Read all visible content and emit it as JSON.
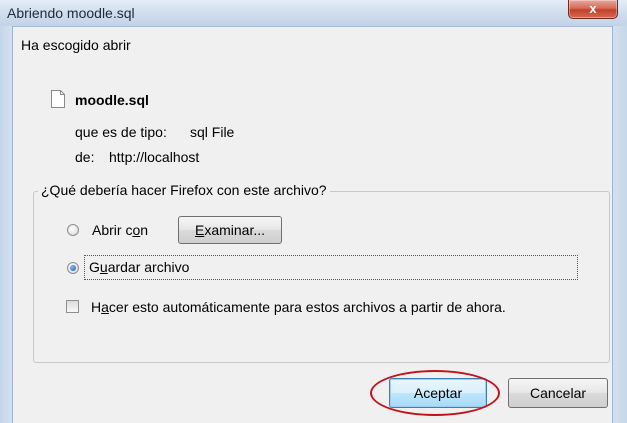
{
  "window": {
    "title": "Abriendo moodle.sql",
    "close_label": "x"
  },
  "info": {
    "intro": "Ha escogido abrir",
    "file_name": "moodle.sql",
    "type_label": "que es de tipo:",
    "type_value": "sql File",
    "from_label": "de:",
    "from_value": "http://localhost"
  },
  "action_group": {
    "legend": "¿Qué debería hacer Firefox con este archivo?",
    "open_with_pre": "Abrir c",
    "open_with_accel": "o",
    "open_with_post": "n",
    "open_with_selected": false,
    "browse_accel": "E",
    "browse_rest": "xaminar...",
    "save_pre": "G",
    "save_accel": "u",
    "save_post": "ardar archivo",
    "save_selected": true,
    "auto_pre": "H",
    "auto_accel": "a",
    "auto_post": "cer esto automáticamente para estos archivos a partir de ahora.",
    "auto_checked": false
  },
  "buttons": {
    "ok": "Aceptar",
    "cancel": "Cancelar"
  },
  "colors": {
    "highlight_ellipse": "#c0141c"
  }
}
